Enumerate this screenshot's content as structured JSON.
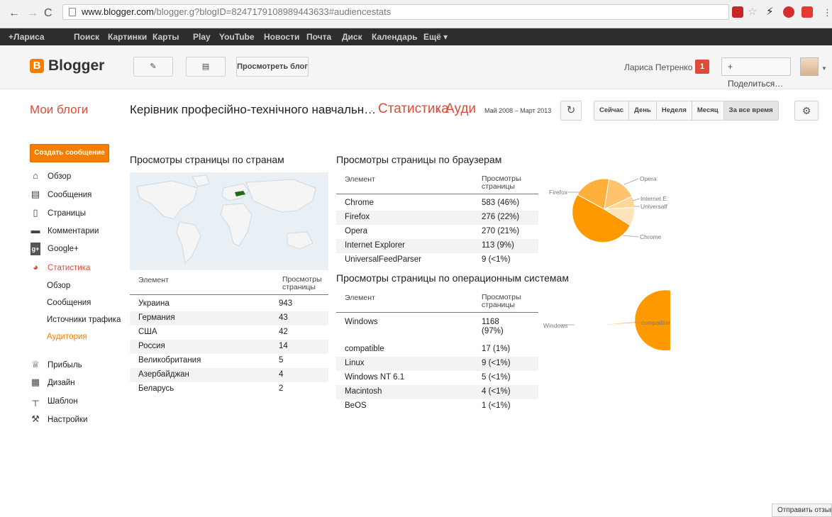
{
  "browser": {
    "url_host": "www.blogger.com",
    "url_rest": "/blogger.g?blogID=8247179108989443633#audiencestats"
  },
  "gbar": {
    "items": [
      "+Лариса",
      "Поиск",
      "Картинки",
      "Карты",
      "Play",
      "YouTube",
      "Новости",
      "Почта",
      "Диск",
      "Календарь",
      "Ещё ▾"
    ]
  },
  "header": {
    "logo_text": "Blogger",
    "view_blog": "Просмотреть блог",
    "user_name": "Лариса Петренко",
    "notification_count": "1",
    "share_label": "+ Поделиться…"
  },
  "titlebar": {
    "my_blogs": "Мои блоги",
    "blog_title": "Керівник професійно-технічного навчальн…",
    "separator": "·",
    "stats": "Статистика",
    "arrow": "›",
    "audience": "Ауди",
    "date_range": "Май 2008 – Март 2013",
    "ranges": [
      "Сейчас",
      "День",
      "Неделя",
      "Месяц",
      "За все время"
    ]
  },
  "sidebar": {
    "new_post": "Создать сообщение",
    "items": [
      {
        "label": "Обзор",
        "icon": "home-icon"
      },
      {
        "label": "Сообщения",
        "icon": "posts-icon"
      },
      {
        "label": "Страницы",
        "icon": "page-icon"
      },
      {
        "label": "Комментарии",
        "icon": "comment-icon"
      },
      {
        "label": "Google+",
        "icon": "google-plus-icon"
      },
      {
        "label": "Статистика",
        "icon": "stats-icon"
      }
    ],
    "subitems": [
      "Обзор",
      "Сообщения",
      "Источники трафика",
      "Аудитория"
    ],
    "items2": [
      {
        "label": "Прибыль",
        "icon": "trophy-icon"
      },
      {
        "label": "Дизайн",
        "icon": "layout-icon"
      },
      {
        "label": "Шаблон",
        "icon": "template-icon"
      },
      {
        "label": "Настройки",
        "icon": "wrench-icon"
      }
    ]
  },
  "countries": {
    "title": "Просмотры страницы по странам",
    "col1": "Элемент",
    "col2": "Просмотры страницы",
    "rows": [
      [
        "Украина",
        "943"
      ],
      [
        "Германия",
        "43"
      ],
      [
        "США",
        "42"
      ],
      [
        "Россия",
        "14"
      ],
      [
        "Великобритания",
        "5"
      ],
      [
        "Азербайджан",
        "4"
      ],
      [
        "Беларусь",
        "2"
      ]
    ]
  },
  "browsers": {
    "title": "Просмотры страницы по браузерам",
    "col1": "Элемент",
    "col2": "Просмотры страницы",
    "rows": [
      [
        "Chrome",
        "583 (46%)"
      ],
      [
        "Firefox",
        "276 (22%)"
      ],
      [
        "Opera",
        "270 (21%)"
      ],
      [
        "Internet Explorer",
        "113 (9%)"
      ],
      [
        "UniversalFeedParser",
        "9 (<1%)"
      ]
    ],
    "pie_labels": [
      "Opera",
      "Internet E:",
      "Universalf",
      "Firefox",
      "Chrome"
    ]
  },
  "os": {
    "title": "Просмотры страницы по операционным системам",
    "col1": "Элемент",
    "col2": "Просмотры страницы",
    "rows": [
      [
        "Windows",
        "1168 (97%)"
      ],
      [
        "compatible",
        "17 (1%)"
      ],
      [
        "Linux",
        "9 (<1%)"
      ],
      [
        "Windows NT 6.1",
        "5 (<1%)"
      ],
      [
        "Macintosh",
        "4 (<1%)"
      ],
      [
        "BeOS",
        "1 (<1%)"
      ]
    ],
    "pie_labels": [
      "Windows",
      "compatible"
    ]
  },
  "feedback": "Отправить отзыв",
  "colors": {
    "accent": "#f57d00",
    "accent_text": "#dd4b39",
    "pie_main": "#ff9900",
    "pie_light": "#ffbd55",
    "pie_lighter": "#ffd69a"
  }
}
